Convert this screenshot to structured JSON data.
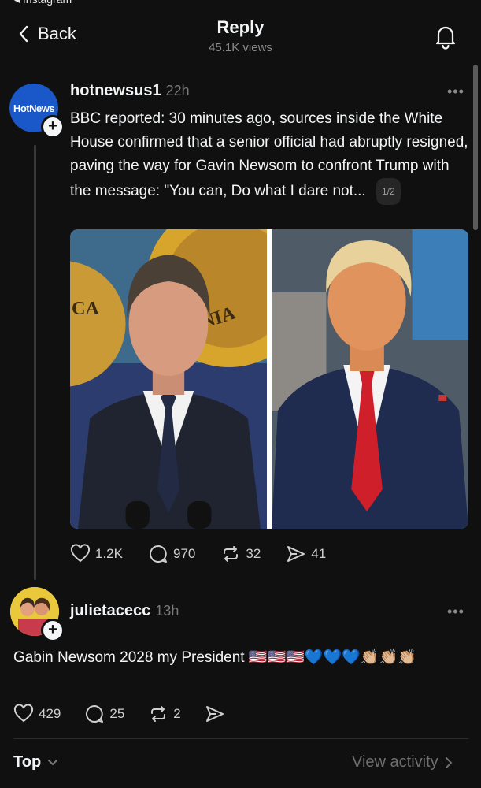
{
  "status_bar": {
    "back_app": "◂ Instagram"
  },
  "header": {
    "back_label": "Back",
    "title": "Reply",
    "views": "45.1K views"
  },
  "post": {
    "username": "hotnewsus1",
    "time": "22h",
    "avatar_logo": "HotNews",
    "text": "BBC reported: 30 minutes ago, sources inside the White House confirmed that a senior official had abruptly resigned, paving the way for Gavin Newsom to confront Trump with the message: \"You can, Do what I dare not...",
    "page_indicator": "1/2",
    "seal_text_left": "CA",
    "seal_text_right": "NIA",
    "likes": "1.2K",
    "comments": "970",
    "reposts": "32",
    "shares": "41"
  },
  "reply": {
    "username": "julietacecc",
    "time": "13h",
    "text": "Gabin Newsom 2028 my President 🇺🇸🇺🇸🇺🇸💙💙💙👏🏼👏🏼👏🏼",
    "likes": "429",
    "comments": "25",
    "reposts": "2"
  },
  "footer": {
    "sort_label": "Top",
    "activity_label": "View activity"
  },
  "colors": {
    "background": "#101010",
    "text": "#f3f5f7",
    "muted": "#7a7a7a",
    "avatar_blue": "#1a57c8",
    "tie_red": "#cf1f2a"
  }
}
